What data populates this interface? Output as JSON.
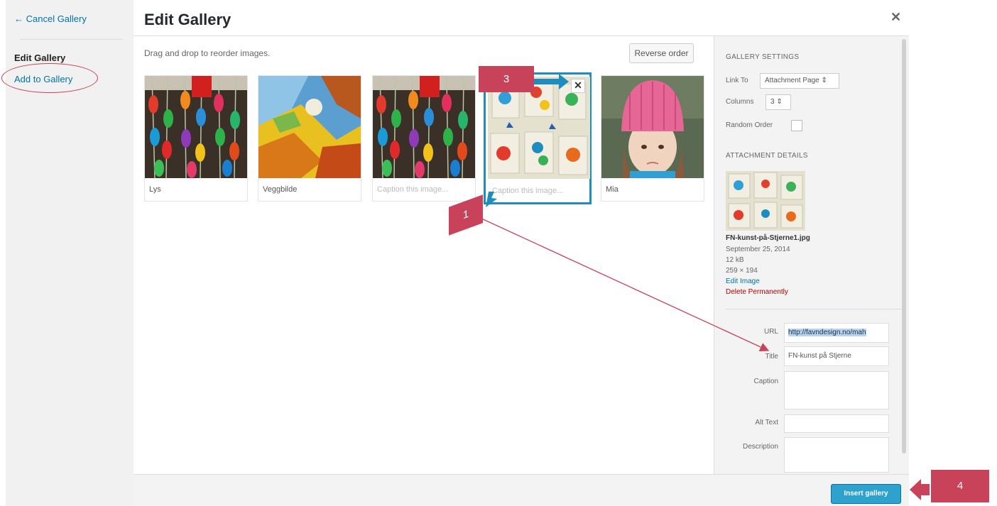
{
  "menu": {
    "cancel": "← Cancel Gallery",
    "edit_gallery": "Edit Gallery",
    "add_to_gallery": "Add to Gallery"
  },
  "title": "Edit Gallery",
  "close_icon": "close-icon",
  "content": {
    "instructions": "Drag and drop to reorder images.",
    "reverse_order": "Reverse order",
    "tiles": [
      {
        "caption": "Lys",
        "placeholder": false
      },
      {
        "caption": "Veggbilde",
        "placeholder": false
      },
      {
        "caption": "Caption this image...",
        "placeholder": true
      },
      {
        "caption": "Caption this image...",
        "placeholder": true,
        "selected": true
      },
      {
        "caption": "Mia",
        "placeholder": false
      }
    ]
  },
  "sidebar": {
    "gallery_settings": "GALLERY SETTINGS",
    "link_to_label": "Link To",
    "link_to_value": "Attachment Page ⇕",
    "columns_label": "Columns",
    "columns_value": "3 ⇕",
    "random_order_label": "Random Order",
    "attachment_details": "ATTACHMENT DETAILS",
    "filename": "FN-kunst-på-Stjerne1.jpg",
    "date": "September 25, 2014",
    "size": "12 kB",
    "dimensions": "259 × 194",
    "edit_image": "Edit Image",
    "delete": "Delete Permanently",
    "fields": {
      "url_label": "URL",
      "url_value": "http://favndesign.no/mah",
      "title_label": "Title",
      "title_value": "FN-kunst på Stjerne",
      "caption_label": "Caption",
      "alt_label": "Alt Text",
      "description_label": "Description"
    }
  },
  "footer": {
    "insert_gallery": "Insert gallery"
  },
  "annotations": [
    "1",
    "3",
    "4"
  ],
  "colors": {
    "accent": "#2ea2cc",
    "selected_border": "#1e8cbe",
    "annotation": "#c8425a",
    "link": "#0073aa",
    "danger": "#a00000"
  }
}
